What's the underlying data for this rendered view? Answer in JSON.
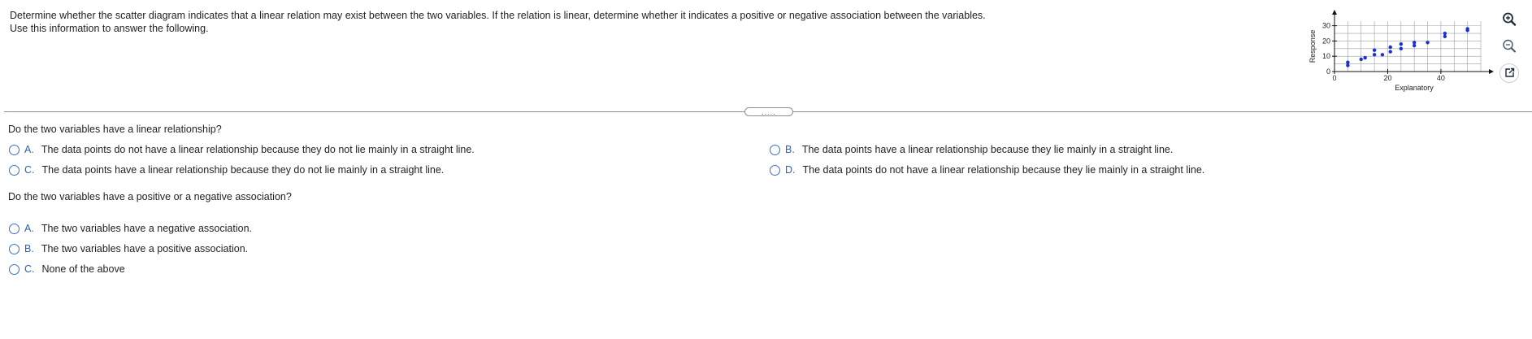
{
  "instructions": {
    "line1": "Determine whether the scatter diagram indicates that a linear relation may exist between the two variables. If the relation is linear, determine whether it indicates a positive or negative association between the variables.",
    "line2": "Use this information to answer the following."
  },
  "chart_data": {
    "type": "scatter",
    "xlabel": "Explanatory",
    "ylabel": "Response",
    "xlim": [
      0,
      55
    ],
    "ylim": [
      0,
      33
    ],
    "x_ticks": [
      0,
      20,
      40
    ],
    "y_ticks": [
      0,
      10,
      20,
      30
    ],
    "grid": true,
    "points": [
      {
        "x": 5,
        "y": 4
      },
      {
        "x": 5,
        "y": 6
      },
      {
        "x": 10,
        "y": 8
      },
      {
        "x": 11.5,
        "y": 9
      },
      {
        "x": 15,
        "y": 11
      },
      {
        "x": 15,
        "y": 14
      },
      {
        "x": 18,
        "y": 11
      },
      {
        "x": 21,
        "y": 13
      },
      {
        "x": 21,
        "y": 16
      },
      {
        "x": 25,
        "y": 15
      },
      {
        "x": 25,
        "y": 18
      },
      {
        "x": 30,
        "y": 17
      },
      {
        "x": 30,
        "y": 19
      },
      {
        "x": 35,
        "y": 19
      },
      {
        "x": 41.5,
        "y": 23
      },
      {
        "x": 41.5,
        "y": 25
      },
      {
        "x": 50,
        "y": 27
      },
      {
        "x": 50,
        "y": 28
      }
    ],
    "point_color": "#1a2fd6"
  },
  "tools": {
    "zoom_in": "zoom-in-icon",
    "zoom_out": "zoom-out-icon",
    "popout": "popout-icon"
  },
  "divider": {
    "handle_label": "....."
  },
  "q1": {
    "prompt": "Do the two variables have a linear relationship?",
    "options": [
      {
        "letter": "A.",
        "text": "The data points do not have a linear relationship because they do not lie mainly in a straight line."
      },
      {
        "letter": "B.",
        "text": "The data points have a linear relationship because they lie mainly in a straight line."
      },
      {
        "letter": "C.",
        "text": "The data points have a linear relationship because they do not lie mainly in a straight line."
      },
      {
        "letter": "D.",
        "text": "The data points do not have a linear relationship because they lie mainly in a straight line."
      }
    ]
  },
  "q2": {
    "prompt": "Do the two variables have a positive or a negative association?",
    "options": [
      {
        "letter": "A.",
        "text": "The two variables have a negative association."
      },
      {
        "letter": "B.",
        "text": "The two variables have a positive association."
      },
      {
        "letter": "C.",
        "text": "None of the above"
      }
    ]
  },
  "colors": {
    "accent": "#2f5fb3",
    "radio": "#3a6fc4",
    "divider": "#8a8f99"
  }
}
